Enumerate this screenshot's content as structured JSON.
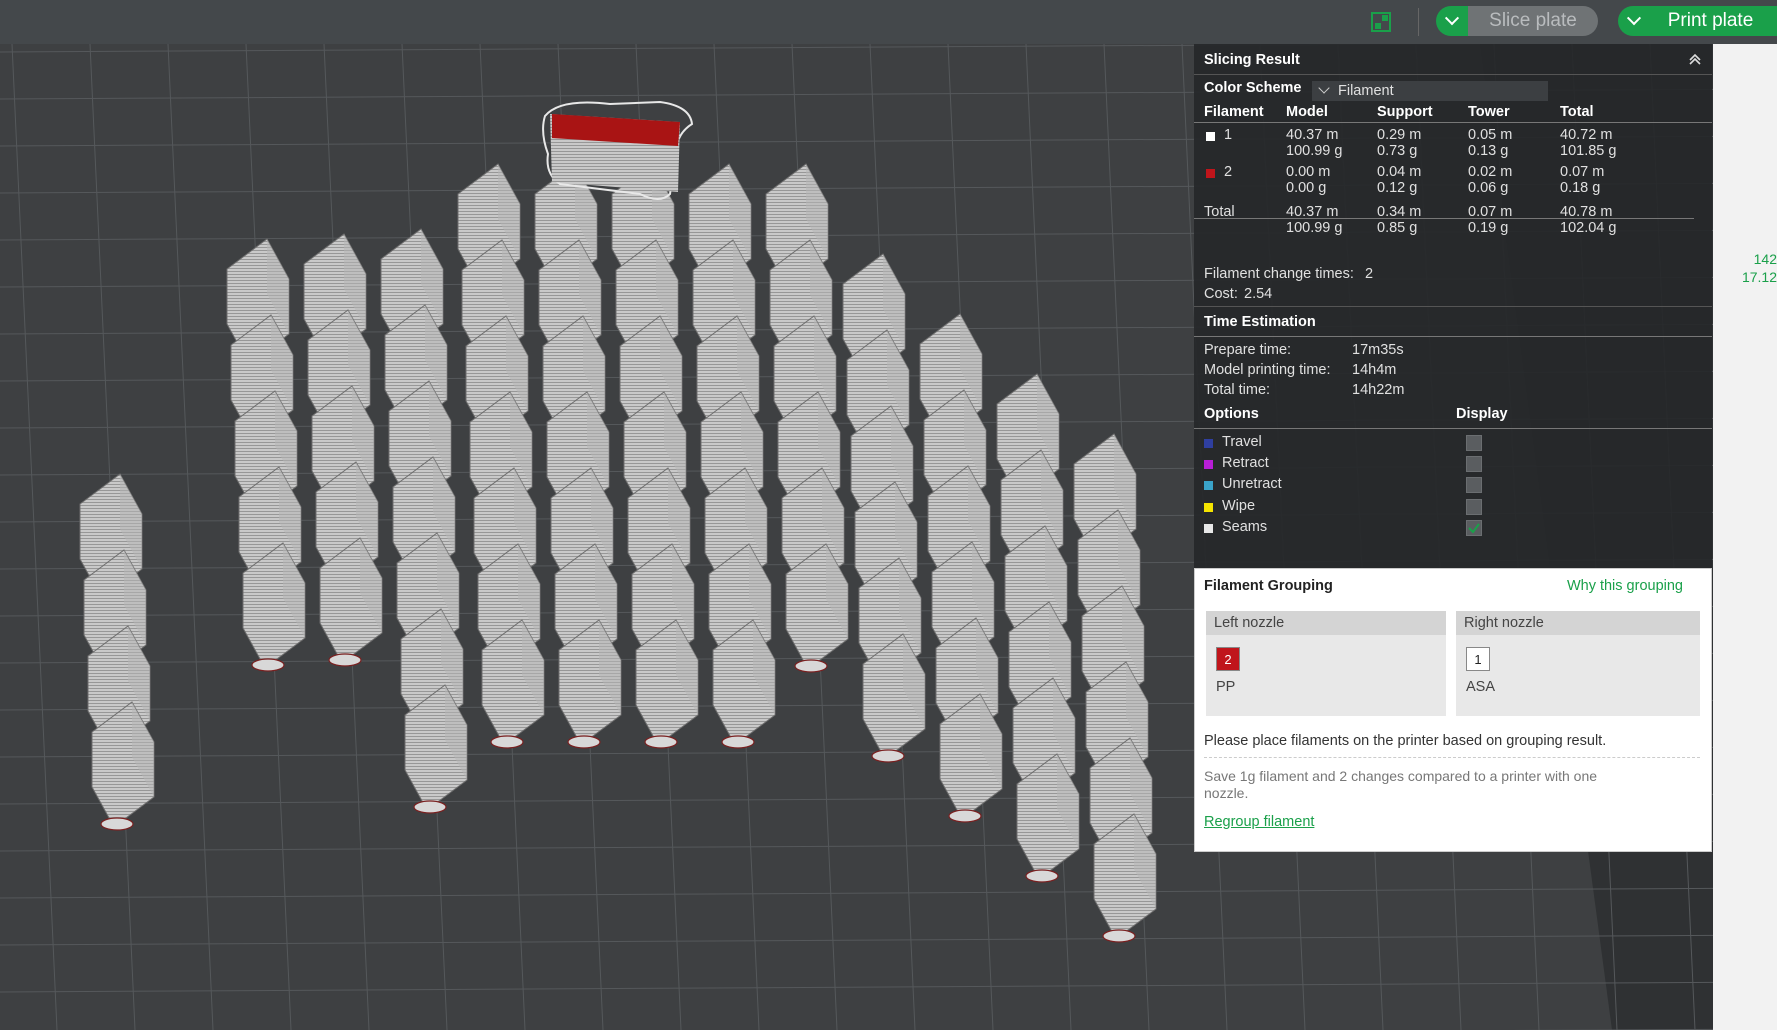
{
  "toolbar": {
    "slice_label": "Slice plate",
    "print_label": "Print plate"
  },
  "layer_readout": {
    "top": "142",
    "bottom": "17.12"
  },
  "slicing": {
    "title": "Slicing Result",
    "color_scheme_label": "Color Scheme",
    "color_scheme_value": "Filament",
    "headers": [
      "Filament",
      "Model",
      "Support",
      "Tower",
      "Total"
    ],
    "rows": [
      {
        "id": "1",
        "color": "#ffffff",
        "model": [
          "40.37 m",
          "100.99 g"
        ],
        "support": [
          "0.29 m",
          "0.73 g"
        ],
        "tower": [
          "0.05 m",
          "0.13 g"
        ],
        "total": [
          "40.72 m",
          "101.85 g"
        ]
      },
      {
        "id": "2",
        "color": "#c0151b",
        "model": [
          "0.00 m",
          "0.00 g"
        ],
        "support": [
          "0.04 m",
          "0.12 g"
        ],
        "tower": [
          "0.02 m",
          "0.06 g"
        ],
        "total": [
          "0.07 m",
          "0.18 g"
        ]
      }
    ],
    "total_row": {
      "label": "Total",
      "model": [
        "40.37 m",
        "100.99 g"
      ],
      "support": [
        "0.34 m",
        "0.85 g"
      ],
      "tower": [
        "0.07 m",
        "0.19 g"
      ],
      "total": [
        "40.78 m",
        "102.04 g"
      ]
    },
    "change_times_label": "Filament change times:",
    "change_times_value": "2",
    "cost_label": "Cost:",
    "cost_value": "2.54"
  },
  "time": {
    "title": "Time Estimation",
    "prepare_label": "Prepare time:",
    "prepare_value": "17m35s",
    "model_label": "Model printing time:",
    "model_value": "14h4m",
    "total_label": "Total time:",
    "total_value": "14h22m"
  },
  "options": {
    "title": "Options",
    "display_label": "Display",
    "items": [
      {
        "label": "Travel",
        "color": "#2f3fa0",
        "checked": false
      },
      {
        "label": "Retract",
        "color": "#b81ed6",
        "checked": false
      },
      {
        "label": "Unretract",
        "color": "#3aa3c9",
        "checked": false
      },
      {
        "label": "Wipe",
        "color": "#f5e400",
        "checked": false
      },
      {
        "label": "Seams",
        "color": "#e8e8e8",
        "checked": true
      }
    ]
  },
  "grouping": {
    "title": "Filament Grouping",
    "why_link": "Why this grouping",
    "left_label": "Left nozzle",
    "left_filament_id": "2",
    "left_filament_name": "PP",
    "left_color": "#c0151b",
    "right_label": "Right nozzle",
    "right_filament_id": "1",
    "right_filament_name": "ASA",
    "right_color": "#ffffff",
    "instruction": "Please place filaments on the printer based on grouping result.",
    "savings_line1": "Save 1g filament and 2 changes compared to a printer with one",
    "savings_line2": "nozzle.",
    "regroup_link": "Regroup filament"
  }
}
